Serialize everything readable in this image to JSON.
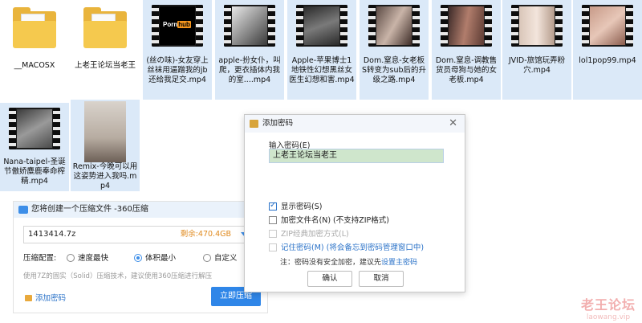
{
  "files": [
    {
      "name": "__MACOSX",
      "type": "folder"
    },
    {
      "name": "上老王论坛当老王",
      "type": "folder"
    },
    {
      "name": "(丝の味)-女友穿上丝袜用逼蹭我的jb还给我足交.mp4",
      "type": "video"
    },
    {
      "name": "apple-扮女仆，叫爬，更衣插体内我的室....mp4",
      "type": "video"
    },
    {
      "name": "Apple-苹果博士1地铁性幻想黑丝女医生幻想和害.mp4",
      "type": "video"
    },
    {
      "name": "Dom.窒息-女老板S转变为sub后的升级之路.mp4",
      "type": "video"
    },
    {
      "name": "Dom.窒息-调教售货员母狗与她的女老板.mp4",
      "type": "video"
    },
    {
      "name": "JVID-旅馆玩弄粉穴.mp4",
      "type": "video"
    },
    {
      "name": "lol1pop99.mp4",
      "type": "video"
    },
    {
      "name": "Nana-taipel-圣诞节傲娇麋鹿奉命榨精.mp4",
      "type": "video"
    },
    {
      "name": "Remix-今晚可以用这姿势进入我吗.mp4",
      "type": "video"
    }
  ],
  "compress_panel": {
    "title": "您将创建一个压缩文件 -360压缩",
    "filename": "1413414.7z",
    "free_space": "剩余:470.4GB",
    "config_label": "压缩配置:",
    "options": [
      "速度最快",
      "体积最小",
      "自定义"
    ],
    "selected_option": "体积最小",
    "note": "使用7Z的固实（Solid）压缩技术，建议使用360压缩进行解压",
    "add_password": "添加密码",
    "compress_now": "立即压缩"
  },
  "password_dialog": {
    "title": "添加密码",
    "input_label": "输入密码(E)",
    "password_value": "上老王论坛当老王",
    "show_password": "显示密码(S)",
    "show_password_checked": true,
    "encrypt_names": "加密文件名(N) (不支持ZIP格式)",
    "encrypt_names_checked": false,
    "zip_classic": "ZIP经典加密方式(L)",
    "remember_password": "记住密码(M) (将会备忘到密码管理窗口中)",
    "tip_prefix": "注：密码没有安全加密，建议先",
    "tip_link": "设置主密码",
    "ok": "确认",
    "cancel": "取消"
  },
  "watermark": {
    "text": "老王论坛",
    "url": "laowang.vip"
  }
}
